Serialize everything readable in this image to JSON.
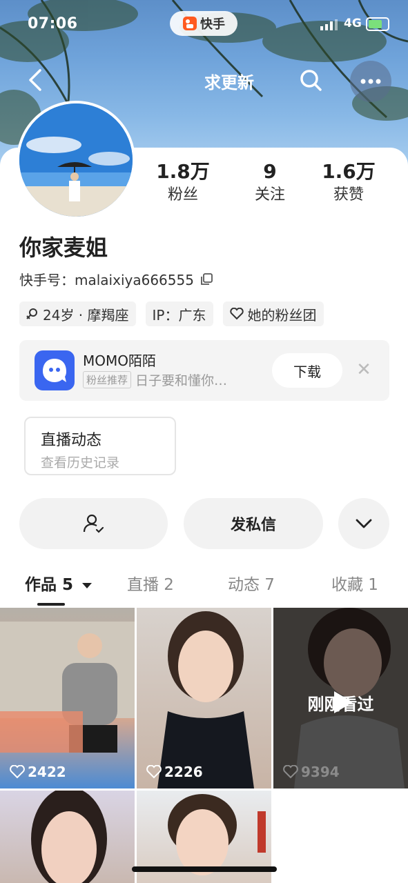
{
  "status_bar": {
    "time": "07:06",
    "app_pill": "快手",
    "network": "4G"
  },
  "nav": {
    "title": "求更新",
    "back_icon": "back-icon",
    "search_icon": "search-icon",
    "more_icon": "more-icon"
  },
  "profile": {
    "stats": [
      {
        "value": "1.8万",
        "label": "粉丝"
      },
      {
        "value": "9",
        "label": "关注"
      },
      {
        "value": "1.6万",
        "label": "获赞"
      }
    ],
    "name": "你家麦姐",
    "ks_id": "快手号：malaixiya666555",
    "tags": {
      "age": "24岁 · 摩羯座",
      "ip": "IP：广东",
      "fans_group": "她的粉丝团"
    }
  },
  "ad": {
    "app_name": "MOMO陌陌",
    "badge": "粉丝推荐",
    "desc": "日子要和懂你…",
    "download": "下载",
    "close": "✕"
  },
  "live": {
    "title": "直播动态",
    "subtitle": "查看历史记录"
  },
  "actions": {
    "message": "发私信"
  },
  "tabs": [
    {
      "label": "作品 5",
      "active": true
    },
    {
      "label": "直播 2"
    },
    {
      "label": "动态 7"
    },
    {
      "label": "收藏 1"
    }
  ],
  "videos": [
    {
      "likes": "2422"
    },
    {
      "likes": "2226"
    },
    {
      "likes": "9394",
      "overlay": "刚刚看过"
    },
    {
      "likes": ""
    },
    {
      "likes": ""
    }
  ],
  "colors": {
    "accent": "#ff5a1f",
    "sky": "#6fa3da"
  }
}
